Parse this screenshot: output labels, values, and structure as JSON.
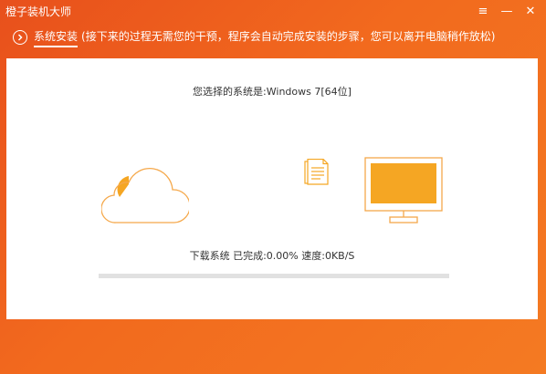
{
  "window": {
    "title": "橙子装机大师",
    "controls": [
      {
        "name": "menu-icon",
        "glyph": "≡"
      },
      {
        "name": "minimize-icon",
        "glyph": "—"
      },
      {
        "name": "close-icon",
        "glyph": "✕"
      }
    ]
  },
  "step": {
    "label": "系统安装",
    "description": "(接下来的过程无需您的干预，程序会自动完成安装的步骤，您可以离开电脑稍作放松)"
  },
  "install": {
    "selected_system_label": "您选择的系统是:Windows 7[64位]",
    "status_text": "下载系统  已完成:0.00%  速度:0KB/S",
    "progress_fraction": 0.0
  },
  "colors": {
    "brand_orange": "#f26a1e",
    "icon_orange": "#f5a623",
    "outline_orange": "#f5a84a",
    "track_gray": "#e1e1e1"
  },
  "icons": [
    "cloud-icon",
    "document-icon",
    "monitor-icon",
    "chevron-right-icon"
  ]
}
